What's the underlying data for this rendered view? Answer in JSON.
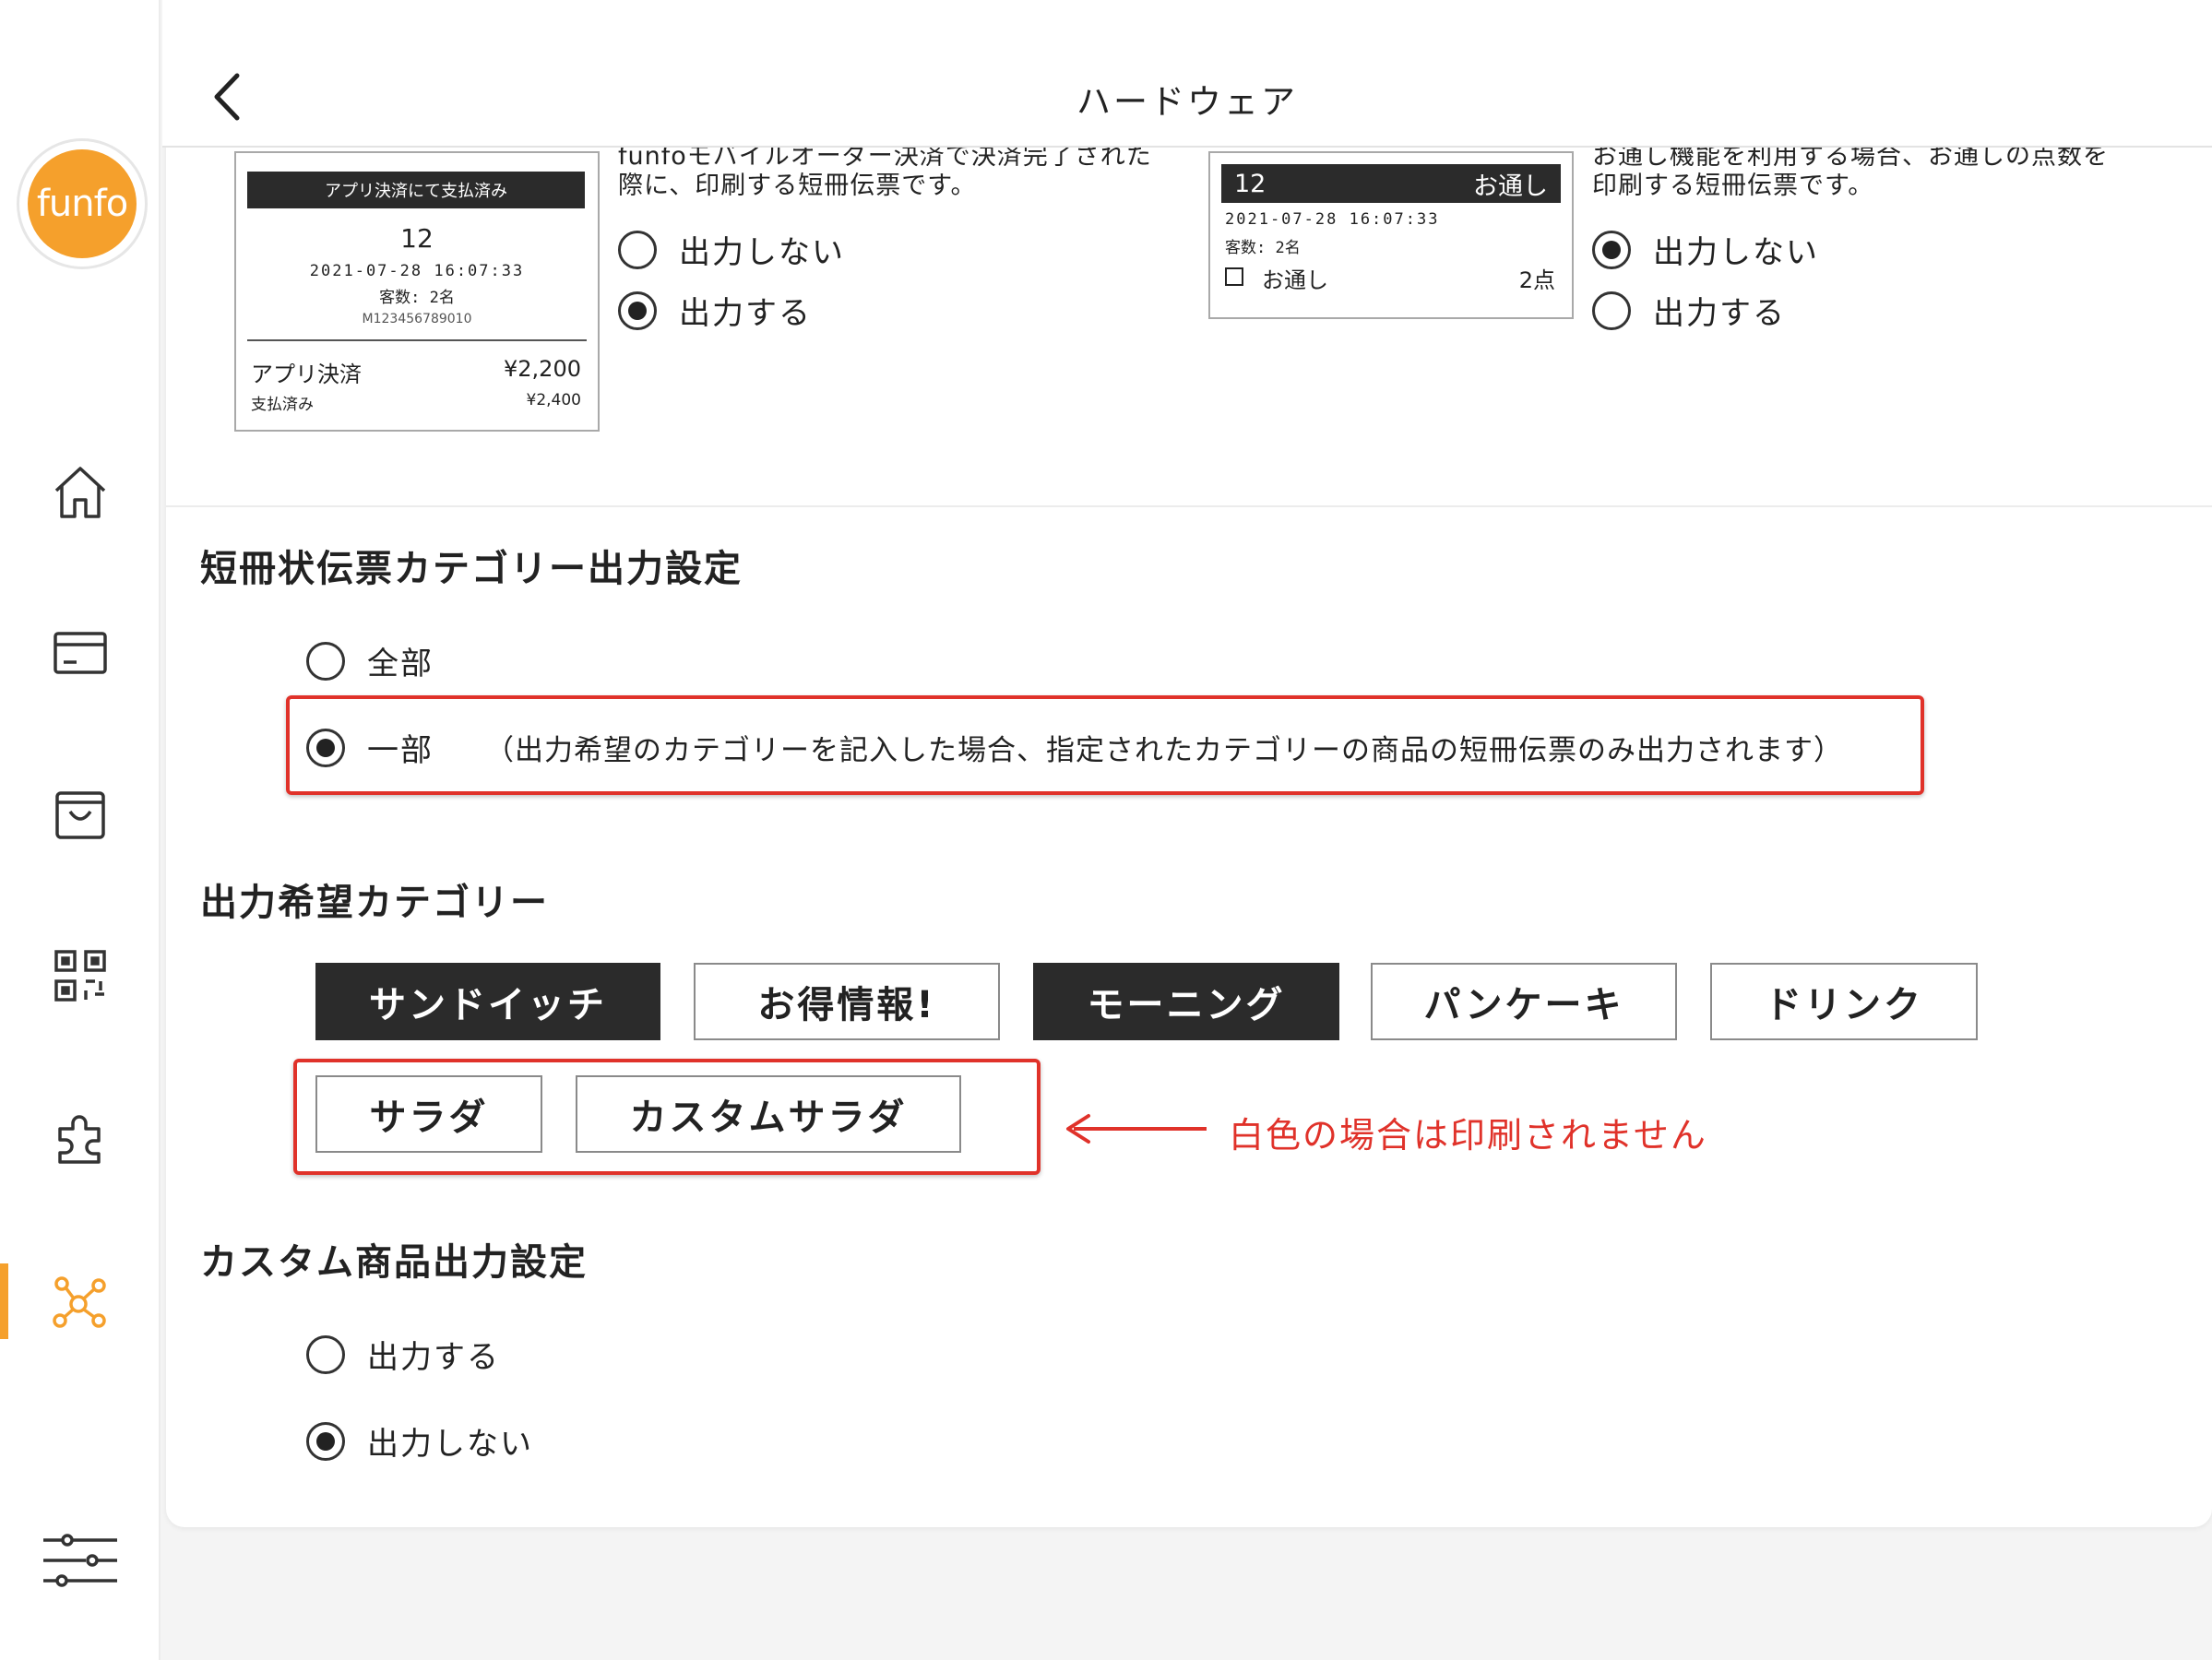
{
  "app": {
    "logo_text": "funfo",
    "brand_color": "#f5a02c"
  },
  "header": {
    "title": "ハードウェア",
    "back_icon": "chevron-left-icon"
  },
  "sidebar": {
    "items": [
      {
        "name": "home",
        "icon": "home-icon",
        "active": false
      },
      {
        "name": "payment",
        "icon": "card-icon",
        "active": false
      },
      {
        "name": "orders",
        "icon": "shopping-bag-icon",
        "active": false
      },
      {
        "name": "qr",
        "icon": "qr-code-icon",
        "active": false
      },
      {
        "name": "plugins",
        "icon": "puzzle-icon",
        "active": false
      },
      {
        "name": "hardware",
        "icon": "network-icon",
        "active": true
      },
      {
        "name": "settings",
        "icon": "sliders-icon",
        "active": false
      }
    ]
  },
  "receipt_app": {
    "header": "アプリ決済にて支払済み",
    "number": "12",
    "datetime": "2021-07-28  16:07:33",
    "guests": "客数: 2名",
    "order_id": "M123456789010",
    "pay_label": "アプリ決済",
    "pay_amount": "¥2,200",
    "paid_label": "支払済み",
    "paid_amount": "¥2,400"
  },
  "app_payment_setting": {
    "desc_line1": "funfoモバイルオーダー決済で決済完了された",
    "desc_line2": "際に、印刷する短冊伝票です。",
    "option_no": "出力しない",
    "option_yes": "出力する",
    "selected": "yes"
  },
  "receipt_otoshi": {
    "number": "12",
    "header_right": "お通し",
    "datetime": "2021-07-28  16:07:33",
    "guests": "客数: 2名",
    "item": "お通し",
    "item_qty": "2点"
  },
  "otoshi_setting": {
    "desc_line1": "お通し機能を利用する場合、お通しの点数を",
    "desc_line2": "印刷する短冊伝票です。",
    "option_no": "出力しない",
    "option_yes": "出力する",
    "selected": "no"
  },
  "category_output": {
    "title": "短冊状伝票カテゴリー出力設定",
    "option_all": "全部",
    "option_partial": "一部",
    "partial_note": "（出力希望のカテゴリーを記入した場合、指定されたカテゴリーの商品の短冊伝票のみ出力されます）",
    "selected": "partial"
  },
  "desired_categories": {
    "title": "出力希望カテゴリー",
    "chips": [
      {
        "label": "サンドイッチ",
        "selected": true
      },
      {
        "label": "お得情報!",
        "selected": false
      },
      {
        "label": "モーニング",
        "selected": true
      },
      {
        "label": "パンケーキ",
        "selected": false
      },
      {
        "label": "ドリンク",
        "selected": false
      },
      {
        "label": "サラダ",
        "selected": false
      },
      {
        "label": "カスタムサラダ",
        "selected": false
      }
    ],
    "annotation": "白色の場合は印刷されません",
    "annotation_color": "#e0322a"
  },
  "custom_product": {
    "title": "カスタム商品出力設定",
    "option_yes": "出力する",
    "option_no": "出力しない",
    "selected": "no"
  }
}
